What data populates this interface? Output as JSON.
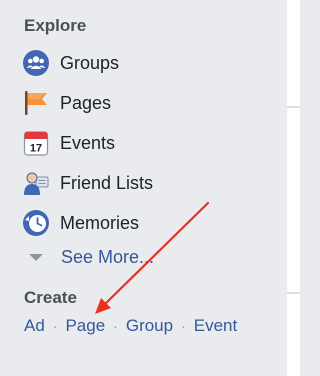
{
  "explore": {
    "title": "Explore",
    "items": [
      {
        "label": "Groups",
        "icon": "groups-icon"
      },
      {
        "label": "Pages",
        "icon": "pages-flag-icon"
      },
      {
        "label": "Events",
        "icon": "calendar-icon",
        "day": "17"
      },
      {
        "label": "Friend Lists",
        "icon": "friend-lists-icon"
      },
      {
        "label": "Memories",
        "icon": "memories-clock-icon"
      }
    ],
    "see_more": "See More..."
  },
  "create": {
    "title": "Create",
    "links": [
      "Ad",
      "Page",
      "Group",
      "Event"
    ],
    "separator": "·"
  },
  "colors": {
    "background": "#e9ebee",
    "link": "#365899",
    "arrow": "#e8311f",
    "groups_blue": "#4267b2",
    "pages_orange": "#f7923a",
    "events_red": "#e0393e"
  }
}
